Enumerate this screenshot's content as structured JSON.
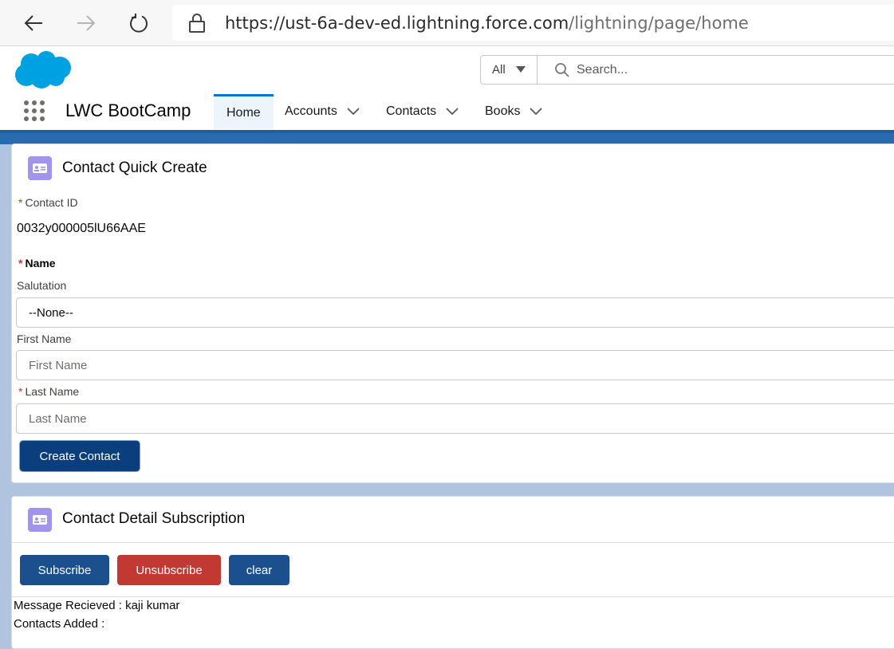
{
  "browser": {
    "url_main": "https://ust-6a-dev-ed.lightning.force.com",
    "url_path": "/lightning/page/home"
  },
  "header": {
    "search_scope": "All",
    "search_placeholder": "Search..."
  },
  "nav": {
    "app_name": "LWC BootCamp",
    "tabs": [
      {
        "label": "Home"
      },
      {
        "label": "Accounts"
      },
      {
        "label": "Contacts"
      },
      {
        "label": "Books"
      }
    ]
  },
  "quick_create": {
    "title": "Contact Quick Create",
    "required_mark": "*",
    "contact_id_label": "Contact ID",
    "contact_id_value": "0032y000005lU66AAE",
    "name_label": "Name",
    "salutation_label": "Salutation",
    "salutation_value": "--None--",
    "first_name_label": "First Name",
    "first_name_placeholder": "First Name",
    "last_name_label": "Last Name",
    "last_name_placeholder": "Last Name",
    "create_button": "Create Contact"
  },
  "subscription": {
    "title": "Contact Detail Subscription",
    "subscribe_button": "Subscribe",
    "unsubscribe_button": "Unsubscribe",
    "clear_button": "clear",
    "message_received": "Message Recieved : kaji kumar",
    "contacts_added": "Contacts Added :"
  },
  "colors": {
    "brand_blue": "#1b5fa0",
    "button_blue": "#1b4f8e",
    "button_red": "#c23934",
    "card_icon": "#a094ed"
  },
  "icons": [
    "back-arrow-icon",
    "forward-arrow-icon",
    "refresh-icon",
    "lock-icon",
    "salesforce-cloud-logo",
    "search-icon",
    "app-launcher-icon",
    "chevron-down-icon",
    "contact-card-icon"
  ]
}
